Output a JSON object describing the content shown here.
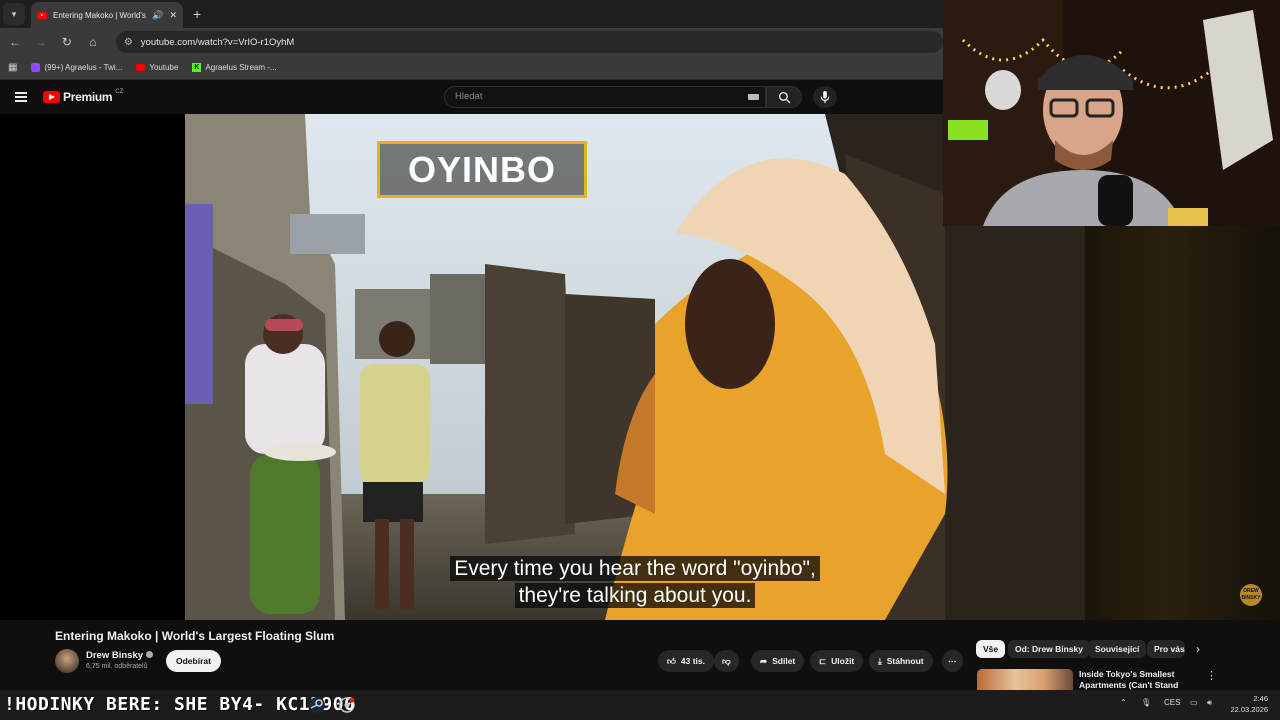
{
  "browser": {
    "tab_title": "Entering Makoko | World's",
    "url": "youtube.com/watch?v=VrIO-r1OyhM",
    "bookmarks": [
      {
        "label": "(99+) Agraelus - Twi...",
        "icon": "twitch-icon"
      },
      {
        "label": "Youtube",
        "icon": "youtube-icon"
      },
      {
        "label": "Agraelus Stream -...",
        "icon": "kick-icon"
      }
    ]
  },
  "youtube": {
    "logo_text": "Premium",
    "logo_region": "CZ",
    "search_placeholder": "Hledat"
  },
  "video": {
    "overlay_word": "OYINBO",
    "subtitle_line1": "Every time you hear the word \"oyinbo\",",
    "subtitle_line2": "they're talking about you.",
    "watermark": "DREW BINSKY",
    "title": "Entering Makoko | World's Largest Floating Slum"
  },
  "channel": {
    "name": "Drew Binsky",
    "subscribers": "6,75 mil. odběratelů",
    "subscribe_label": "Odebírat"
  },
  "actions": {
    "likes": "43 tis.",
    "share": "Sdílet",
    "save": "Uložit",
    "download": "Stáhnout"
  },
  "chips": [
    "Vše",
    "Od: Drew Binsky",
    "Související",
    "Pro vás"
  ],
  "recommendation": {
    "title": "Inside Tokyo's Smallest Apartments (Can't Stand Up)"
  },
  "taskbar": {
    "ticker": "!HODINKY BERE: SHE  BY4- KC12900",
    "language": "CES",
    "time": "2:46",
    "date": "22.03.2026"
  }
}
